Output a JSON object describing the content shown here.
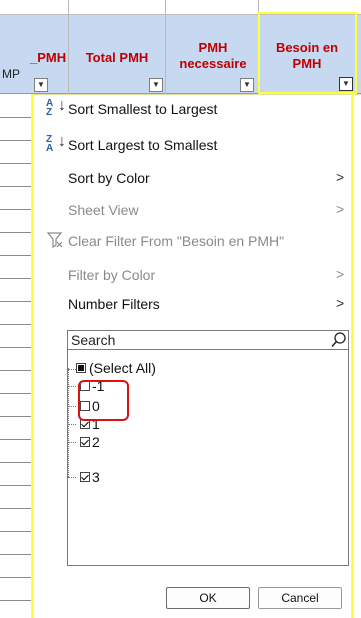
{
  "headers": {
    "col_pmh_partial": "_PMH",
    "col_pmh_partial_sub": "MP",
    "total_pmh": "Total PMH",
    "pmh_necessaire": "PMH necessaire",
    "besoin_en_pmh": "Besoin en PMH"
  },
  "menu": {
    "sort_asc": "Sort Smallest to Largest",
    "sort_desc": "Sort Largest to Smallest",
    "sort_by_color": "Sort by Color",
    "sheet_view": "Sheet View",
    "clear_filter": "Clear Filter From \"Besoin en PMH\"",
    "filter_by_color": "Filter by Color",
    "number_filters": "Number Filters"
  },
  "search": {
    "placeholder": "Search"
  },
  "values": [
    {
      "label": "(Select All)",
      "state": "partial"
    },
    {
      "label": "-1",
      "state": "unchecked"
    },
    {
      "label": "0",
      "state": "unchecked"
    },
    {
      "label": "1",
      "state": "checked"
    },
    {
      "label": "2",
      "state": "checked"
    },
    {
      "label": "3",
      "state": "checked"
    }
  ],
  "buttons": {
    "ok": "OK",
    "cancel": "Cancel"
  },
  "colors": {
    "header_bg": "#c6d9f1",
    "header_text": "#c00000",
    "highlight": "#ffff3b",
    "annotation": "#e01010"
  }
}
